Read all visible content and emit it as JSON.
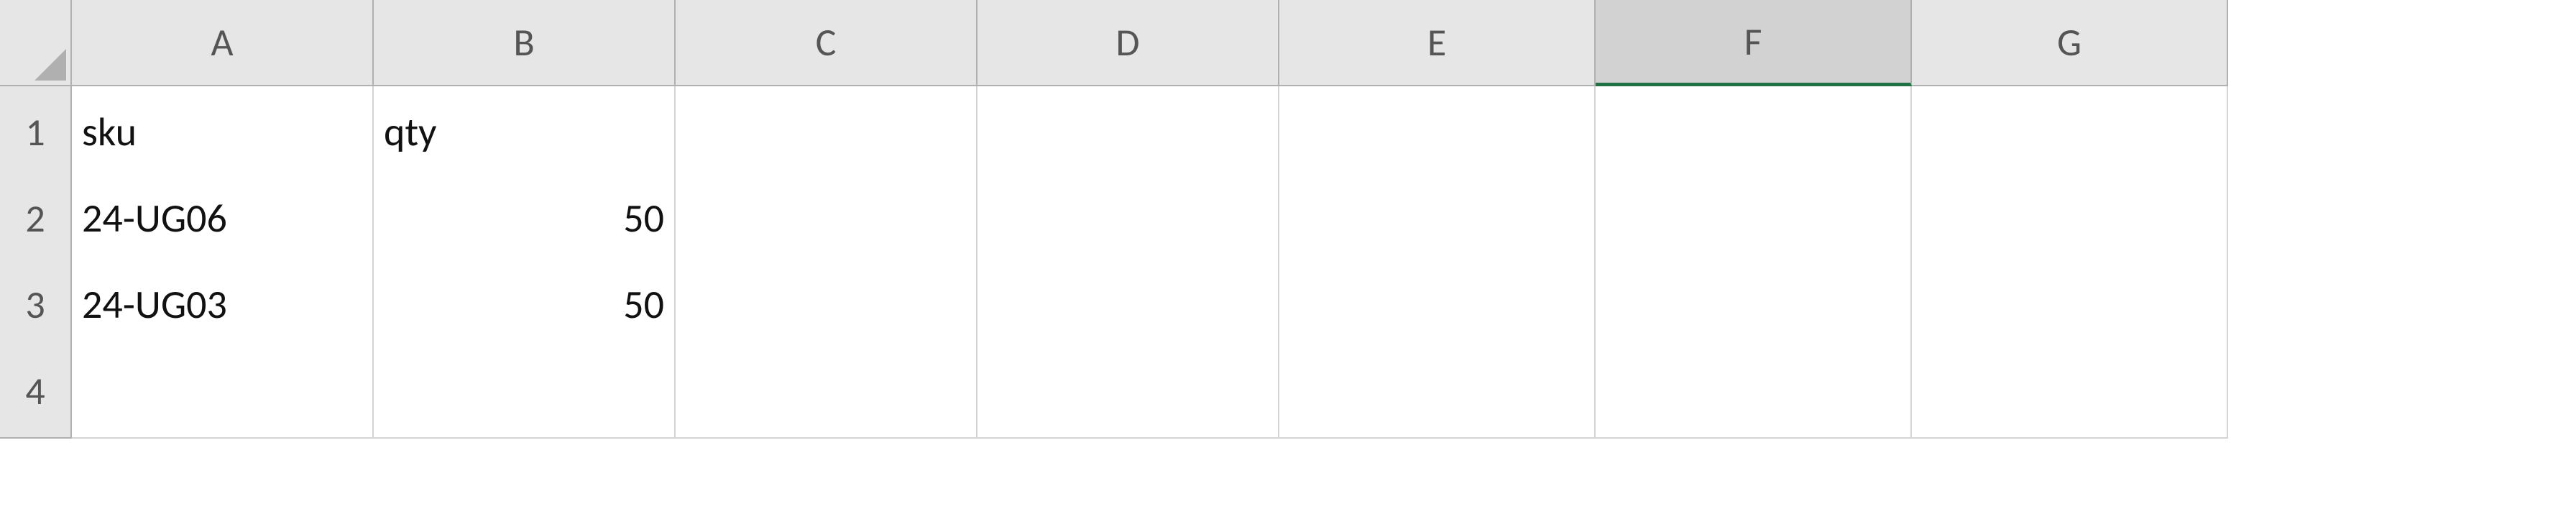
{
  "columns": [
    "A",
    "B",
    "C",
    "D",
    "E",
    "F",
    "G"
  ],
  "rows": [
    "1",
    "2",
    "3",
    "4"
  ],
  "selectedColumn": "F",
  "grid": {
    "A1": "sku",
    "B1": "qty",
    "A2": "24-UG06",
    "B2": "50",
    "A3": "24-UG03",
    "B3": "50"
  }
}
